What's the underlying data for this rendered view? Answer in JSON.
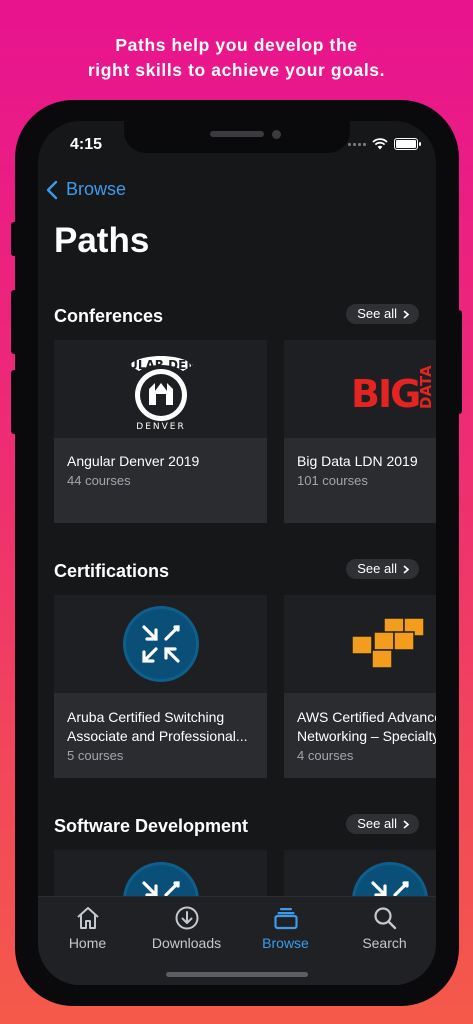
{
  "promo": {
    "line1": "Paths help you develop the",
    "line2": "right skills to achieve your goals."
  },
  "status_bar": {
    "time": "4:15",
    "icons": [
      "signal-icon",
      "wifi-icon",
      "battery-icon"
    ]
  },
  "nav": {
    "back_label": "Browse"
  },
  "page_title": "Paths",
  "colors": {
    "accent": "#3d9be9",
    "background_top": "#e8138f",
    "background_bottom": "#f45a49",
    "screen_bg": "#161719"
  },
  "sections": [
    {
      "title": "Conferences",
      "see_all": "See all",
      "cards": [
        {
          "title": "Angular Denver 2019",
          "subtitle": "44 courses",
          "logo": "angular-denver-logo",
          "logo_text": "ANGULAR DENVER"
        },
        {
          "title": "Big Data LDN 2019",
          "subtitle": "101 courses",
          "logo": "big-data-logo",
          "logo_text": "BIG DATA"
        }
      ]
    },
    {
      "title": "Certifications",
      "see_all": "See all",
      "cards": [
        {
          "title": "Aruba Certified Switching",
          "title2": "Associate and Professional...",
          "subtitle": "5 courses",
          "logo": "arrows-badge-icon"
        },
        {
          "title": "AWS Certified Advanced",
          "title2": "Networking – Specialty",
          "subtitle": "4 courses",
          "logo": "aws-cubes-icon"
        }
      ]
    },
    {
      "title": "Software Development",
      "see_all": "See all",
      "cards": [
        {
          "logo": "arrows-badge-icon"
        },
        {
          "logo": "arrows-badge-icon"
        }
      ]
    }
  ],
  "tabbar": [
    {
      "label": "Home",
      "icon": "home-icon",
      "active": false
    },
    {
      "label": "Downloads",
      "icon": "download-icon",
      "active": false
    },
    {
      "label": "Browse",
      "icon": "browse-icon",
      "active": true
    },
    {
      "label": "Search",
      "icon": "search-icon",
      "active": false
    }
  ]
}
